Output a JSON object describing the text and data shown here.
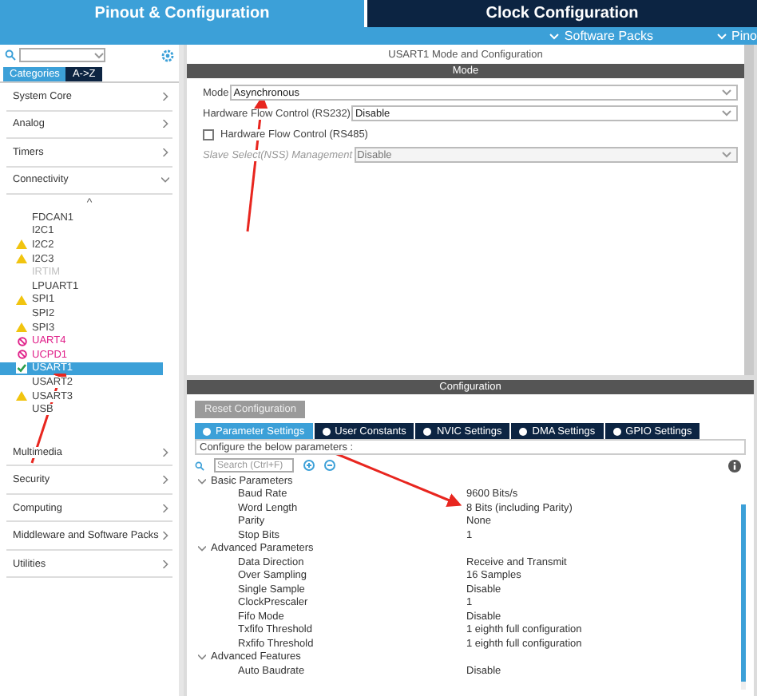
{
  "top_tabs": [
    {
      "label": "Pinout & Configuration",
      "selected": true
    },
    {
      "label": "Clock Configuration",
      "selected": false
    }
  ],
  "sub_links": [
    "Software Packs",
    "Pino"
  ],
  "sidebar": {
    "tabs": [
      {
        "label": "Categories",
        "selected": true
      },
      {
        "label": "A->Z",
        "selected": false
      }
    ],
    "categories_before": [
      {
        "label": "System Core",
        "expanded": false
      },
      {
        "label": "Analog",
        "expanded": false
      },
      {
        "label": "Timers",
        "expanded": false
      },
      {
        "label": "Connectivity",
        "expanded": true
      }
    ],
    "sort_mark": "^",
    "items": [
      {
        "label": "FDCAN1",
        "kind": "plain",
        "selected": false
      },
      {
        "label": "I2C1",
        "kind": "plain",
        "selected": false
      },
      {
        "label": "I2C2",
        "kind": "warning",
        "selected": false
      },
      {
        "label": "I2C3",
        "kind": "warning",
        "selected": false
      },
      {
        "label": "IRTIM",
        "kind": "disabled",
        "selected": false
      },
      {
        "label": "LPUART1",
        "kind": "plain",
        "selected": false
      },
      {
        "label": "SPI1",
        "kind": "warning",
        "selected": false
      },
      {
        "label": "SPI2",
        "kind": "plain",
        "selected": false
      },
      {
        "label": "SPI3",
        "kind": "warning",
        "selected": false
      },
      {
        "label": "UART4",
        "kind": "error",
        "selected": false
      },
      {
        "label": "UCPD1",
        "kind": "error",
        "selected": false
      },
      {
        "label": "USART1",
        "kind": "ok",
        "selected": true
      },
      {
        "label": "USART2",
        "kind": "plain",
        "selected": false
      },
      {
        "label": "USART3",
        "kind": "warning",
        "selected": false
      },
      {
        "label": "USB",
        "kind": "plain",
        "selected": false
      }
    ],
    "categories_after": [
      {
        "label": "Multimedia",
        "expanded": false
      },
      {
        "label": "Security",
        "expanded": false
      },
      {
        "label": "Computing",
        "expanded": false
      },
      {
        "label": "Middleware and Software Packs",
        "expanded": false
      },
      {
        "label": "Utilities",
        "expanded": false
      }
    ]
  },
  "mode_panel": {
    "title": "USART1 Mode and Configuration",
    "header": "Mode",
    "rows": [
      {
        "kind": "select",
        "label": "Mode",
        "value": "Asynchronous",
        "disabled": false
      },
      {
        "kind": "select",
        "label": "Hardware Flow Control (RS232)",
        "value": "Disable",
        "disabled": false
      },
      {
        "kind": "checkbox",
        "label": "Hardware Flow Control (RS485)",
        "checked": false
      },
      {
        "kind": "select",
        "label": "Slave Select(NSS) Management",
        "value": "Disable",
        "disabled": true
      }
    ]
  },
  "config_panel": {
    "header": "Configuration",
    "reset_button": "Reset Configuration",
    "tabs": [
      {
        "label": "Parameter Settings",
        "selected": true
      },
      {
        "label": "User Constants",
        "selected": false
      },
      {
        "label": "NVIC Settings",
        "selected": false
      },
      {
        "label": "DMA Settings",
        "selected": false
      },
      {
        "label": "GPIO Settings",
        "selected": false
      }
    ],
    "hint": "Configure the below parameters :",
    "search_placeholder": "Search (Ctrl+F)",
    "groups": [
      {
        "label": "Basic Parameters",
        "expanded": true,
        "children": [
          {
            "label": "Baud Rate",
            "value": "9600 Bits/s"
          },
          {
            "label": "Word Length",
            "value": "8 Bits (including Parity)"
          },
          {
            "label": "Parity",
            "value": "None"
          },
          {
            "label": "Stop Bits",
            "value": "1"
          }
        ]
      },
      {
        "label": "Advanced Parameters",
        "expanded": true,
        "children": [
          {
            "label": "Data Direction",
            "value": "Receive and Transmit"
          },
          {
            "label": "Over Sampling",
            "value": "16 Samples"
          },
          {
            "label": "Single Sample",
            "value": "Disable"
          },
          {
            "label": "ClockPrescaler",
            "value": "1"
          },
          {
            "label": "Fifo Mode",
            "value": "Disable"
          },
          {
            "label": "Txfifo Threshold",
            "value": "1 eighth full configuration"
          },
          {
            "label": "Rxfifo Threshold",
            "value": "1 eighth full configuration"
          }
        ]
      },
      {
        "label": "Advanced Features",
        "expanded": true,
        "children": [
          {
            "label": "Auto Baudrate",
            "value": "Disable"
          }
        ]
      }
    ]
  }
}
